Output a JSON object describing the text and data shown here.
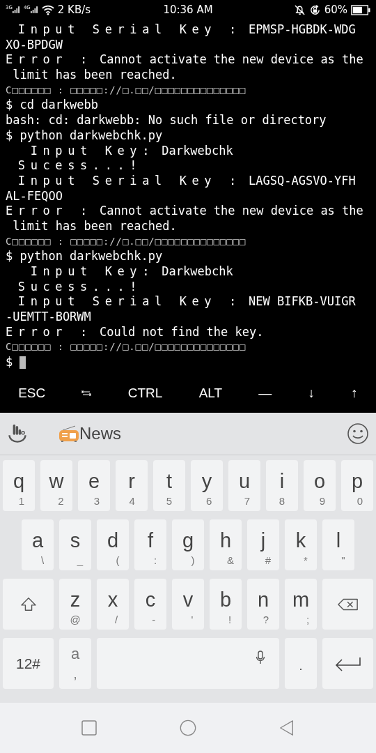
{
  "status_bar": {
    "networks": [
      {
        "label": "3G"
      },
      {
        "label": "4G"
      }
    ],
    "speed": "2 KB/s",
    "time": "10:36 AM",
    "battery_text": "60%"
  },
  "terminal": {
    "lines": [
      {
        "cursor": false,
        "segments": [
          {
            "kind": "spaced",
            "text": " Input Serial Key :"
          },
          {
            "kind": "plain",
            "text": " EPMSP-HGBDK-WDG"
          }
        ]
      },
      {
        "cursor": false,
        "segments": [
          {
            "kind": "plain",
            "text": "XO-BPDGW"
          }
        ]
      },
      {
        "cursor": false,
        "segments": [
          {
            "kind": "spaced",
            "text": "Error :"
          },
          {
            "kind": "plain",
            "text": " Cannot activate the new device as the"
          }
        ]
      },
      {
        "cursor": false,
        "segments": [
          {
            "kind": "plain",
            "text": " limit has been reached."
          }
        ]
      },
      {
        "cursor": false,
        "segments": [
          {
            "kind": "dim",
            "text": "C□□□□□□ : □□□□□://□.□□/□□□□□□□□□□□□□□"
          }
        ]
      },
      {
        "cursor": false,
        "segments": [
          {
            "kind": "plain",
            "text": "$ cd darkwebb"
          }
        ]
      },
      {
        "cursor": false,
        "segments": [
          {
            "kind": "plain",
            "text": "bash: cd: darkwebb: No such file or directory"
          }
        ]
      },
      {
        "cursor": false,
        "segments": [
          {
            "kind": "plain",
            "text": "$ python darkwebchk.py"
          }
        ]
      },
      {
        "cursor": false,
        "segments": [
          {
            "kind": "spaced",
            "text": "  Input Key:"
          },
          {
            "kind": "plain",
            "text": " Darkwebchk"
          }
        ]
      },
      {
        "cursor": false,
        "segments": [
          {
            "kind": "spaced",
            "text": " Sucess...!"
          }
        ]
      },
      {
        "cursor": false,
        "segments": [
          {
            "kind": "spaced",
            "text": " Input Serial Key :"
          },
          {
            "kind": "plain",
            "text": " LAGSQ-AGSVO-YFH"
          }
        ]
      },
      {
        "cursor": false,
        "segments": [
          {
            "kind": "plain",
            "text": "AL-FEQOO"
          }
        ]
      },
      {
        "cursor": false,
        "segments": [
          {
            "kind": "spaced",
            "text": "Error :"
          },
          {
            "kind": "plain",
            "text": " Cannot activate the new device as the"
          }
        ]
      },
      {
        "cursor": false,
        "segments": [
          {
            "kind": "plain",
            "text": " limit has been reached."
          }
        ]
      },
      {
        "cursor": false,
        "segments": [
          {
            "kind": "dim",
            "text": "C□□□□□□ : □□□□□://□.□□/□□□□□□□□□□□□□□"
          }
        ]
      },
      {
        "cursor": false,
        "segments": [
          {
            "kind": "plain",
            "text": "$ python darkwebchk.py"
          }
        ]
      },
      {
        "cursor": false,
        "segments": [
          {
            "kind": "spaced",
            "text": "  Input Key:"
          },
          {
            "kind": "plain",
            "text": " Darkwebchk"
          }
        ]
      },
      {
        "cursor": false,
        "segments": [
          {
            "kind": "spaced",
            "text": " Sucess...!"
          }
        ]
      },
      {
        "cursor": false,
        "segments": [
          {
            "kind": "spaced",
            "text": " Input Serial Key :"
          },
          {
            "kind": "plain",
            "text": " NEW BIFKB-VUIGR"
          }
        ]
      },
      {
        "cursor": false,
        "segments": [
          {
            "kind": "plain",
            "text": "-UEMTT-BORWM"
          }
        ]
      },
      {
        "cursor": false,
        "segments": [
          {
            "kind": "spaced",
            "text": "Error :"
          },
          {
            "kind": "plain",
            "text": " Could not find the key."
          }
        ]
      },
      {
        "cursor": false,
        "segments": [
          {
            "kind": "dim",
            "text": "C□□□□□□ : □□□□□://□.□□/□□□□□□□□□□□□□□"
          }
        ]
      },
      {
        "cursor": true,
        "segments": [
          {
            "kind": "plain",
            "text": "$"
          }
        ]
      }
    ]
  },
  "extra_keys": [
    {
      "kind": "text",
      "label": "ESC"
    },
    {
      "kind": "tab"
    },
    {
      "kind": "text",
      "label": "CTRL"
    },
    {
      "kind": "text",
      "label": "ALT"
    },
    {
      "kind": "text",
      "label": "—"
    },
    {
      "kind": "text",
      "label": "↓"
    },
    {
      "kind": "text",
      "label": "↑"
    }
  ],
  "suggestion_bar": {
    "news_label": "News"
  },
  "keyboard": {
    "rows": [
      {
        "keys": [
          {
            "kind": "char",
            "label": "q",
            "hint": "1"
          },
          {
            "kind": "char",
            "label": "w",
            "hint": "2"
          },
          {
            "kind": "char",
            "label": "e",
            "hint": "3"
          },
          {
            "kind": "char",
            "label": "r",
            "hint": "4"
          },
          {
            "kind": "char",
            "label": "t",
            "hint": "5"
          },
          {
            "kind": "char",
            "label": "y",
            "hint": "6"
          },
          {
            "kind": "char",
            "label": "u",
            "hint": "7"
          },
          {
            "kind": "char",
            "label": "i",
            "hint": "8"
          },
          {
            "kind": "char",
            "label": "o",
            "hint": "9"
          },
          {
            "kind": "char",
            "label": "p",
            "hint": "0"
          }
        ]
      },
      {
        "keys": [
          {
            "kind": "char",
            "label": "a",
            "hint": "\\"
          },
          {
            "kind": "char",
            "label": "s",
            "hint": "_"
          },
          {
            "kind": "char",
            "label": "d",
            "hint": "("
          },
          {
            "kind": "char",
            "label": "f",
            "hint": ":"
          },
          {
            "kind": "char",
            "label": "g",
            "hint": ")"
          },
          {
            "kind": "char",
            "label": "h",
            "hint": "&"
          },
          {
            "kind": "char",
            "label": "j",
            "hint": "#"
          },
          {
            "kind": "char",
            "label": "k",
            "hint": "*"
          },
          {
            "kind": "char",
            "label": "l",
            "hint": "\""
          }
        ]
      },
      {
        "keys": [
          {
            "kind": "shift"
          },
          {
            "kind": "char",
            "label": "z",
            "hint": "@"
          },
          {
            "kind": "char",
            "label": "x",
            "hint": "/"
          },
          {
            "kind": "char",
            "label": "c",
            "hint": "-"
          },
          {
            "kind": "char",
            "label": "v",
            "hint": "'"
          },
          {
            "kind": "char",
            "label": "b",
            "hint": "!"
          },
          {
            "kind": "char",
            "label": "n",
            "hint": "?"
          },
          {
            "kind": "char",
            "label": "m",
            "hint": ";"
          },
          {
            "kind": "backspace"
          }
        ]
      },
      {
        "keys": [
          {
            "kind": "symbols",
            "label": "12#"
          },
          {
            "kind": "dual",
            "label": "a",
            "hint": ","
          },
          {
            "kind": "space"
          },
          {
            "kind": "punct",
            "label": "."
          },
          {
            "kind": "enter"
          }
        ]
      }
    ]
  }
}
